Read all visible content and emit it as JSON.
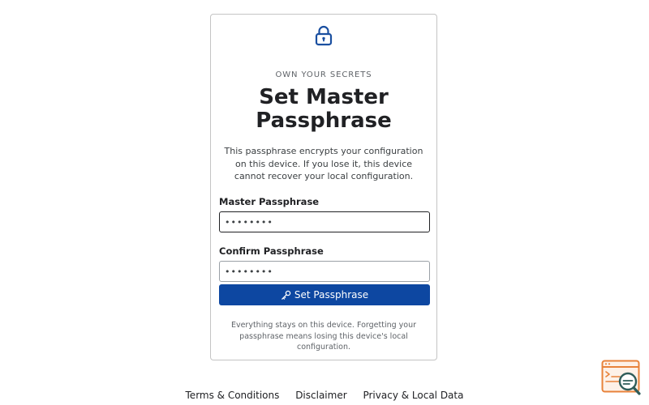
{
  "card": {
    "icon": "lock-icon",
    "eyebrow": "OWN YOUR SECRETS",
    "title": "Set Master Passphrase",
    "description": "This passphrase encrypts your configuration on this device. If you lose it, this device cannot recover your local configuration.",
    "master_label": "Master Passphrase",
    "master_value": "••••••••",
    "confirm_label": "Confirm Passphrase",
    "confirm_value": "••••••••",
    "submit_icon": "key-icon",
    "submit_label": "Set Passphrase",
    "note": "Everything stays on this device. Forgetting your passphrase means losing this device's local configuration."
  },
  "footer": {
    "links": [
      "Terms & Conditions",
      "Disclaimer",
      "Privacy & Local Data"
    ]
  },
  "corner_widget": {
    "icon": "search-console-icon"
  },
  "colors": {
    "accent": "#0d47a1",
    "lock": "#1a4fa0",
    "corner_orange": "#e8823a",
    "corner_teal": "#2f5d5a"
  }
}
